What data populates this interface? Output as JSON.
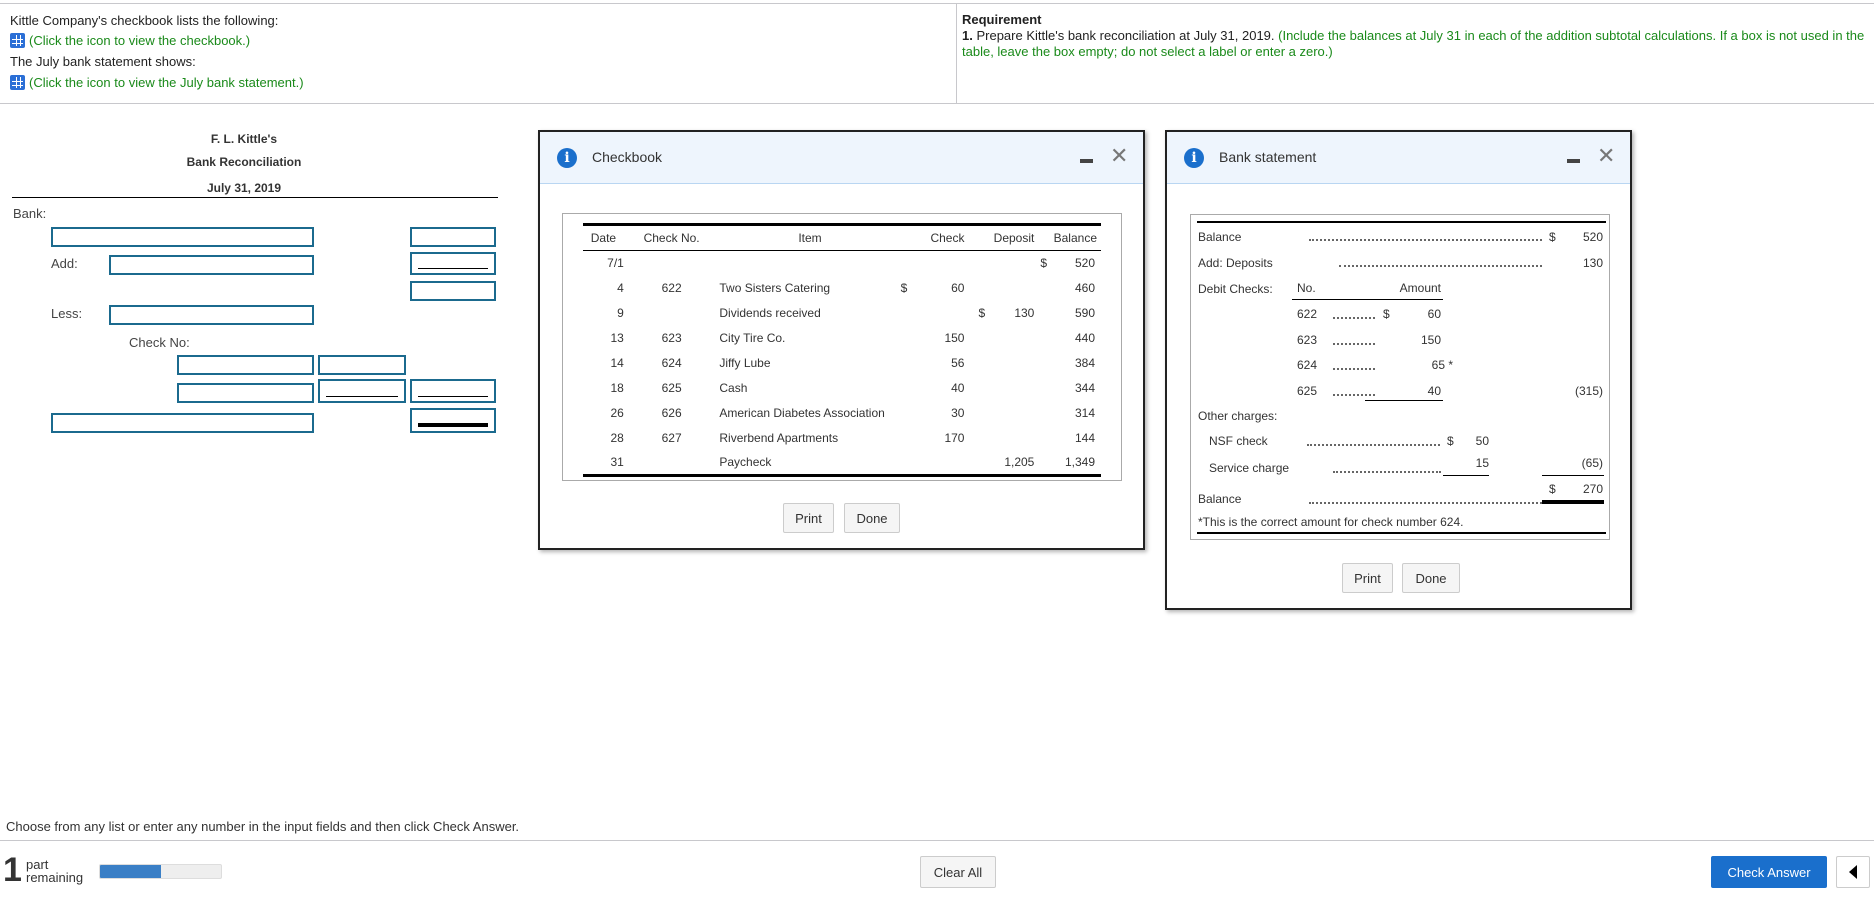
{
  "problem": {
    "line1": "Kittle Company's checkbook lists the following:",
    "link1": "(Click the icon to view the checkbook.)",
    "line2": "The July bank statement shows:",
    "link2": "(Click the icon to view the July bank statement.)",
    "icon": "table-grid-icon"
  },
  "requirement": {
    "heading": "Requirement",
    "number": "1.",
    "text": "Prepare Kittle's bank reconciliation at July 31, 2019.",
    "hint": "(Include the balances at July 31 in each of the addition subtotal calculations. If a box is not used in the table, leave the box empty; do not select a label or enter a zero.)"
  },
  "reconciliation": {
    "company": "F. L. Kittle's",
    "title": "Bank Reconciliation",
    "date": "July 31, 2019",
    "bank_label": "Bank:",
    "add_label": "Add:",
    "less_label": "Less:",
    "check_no_label": "Check No:"
  },
  "checkbook": {
    "title": "Checkbook",
    "headers": [
      "Date",
      "Check No.",
      "Item",
      "Check",
      "Deposit",
      "Balance"
    ],
    "rows": [
      {
        "date": "7/1",
        "no": "",
        "item": "",
        "check_cur": "",
        "check": "",
        "dep_cur": "",
        "deposit": "",
        "bal_cur": "$",
        "balance": "520"
      },
      {
        "date": "4",
        "no": "622",
        "item": "Two Sisters Catering",
        "check_cur": "$",
        "check": "60",
        "dep_cur": "",
        "deposit": "",
        "bal_cur": "",
        "balance": "460"
      },
      {
        "date": "9",
        "no": "",
        "item": "Dividends received",
        "check_cur": "",
        "check": "",
        "dep_cur": "$",
        "deposit": "130",
        "bal_cur": "",
        "balance": "590"
      },
      {
        "date": "13",
        "no": "623",
        "item": "City Tire Co.",
        "check_cur": "",
        "check": "150",
        "dep_cur": "",
        "deposit": "",
        "bal_cur": "",
        "balance": "440"
      },
      {
        "date": "14",
        "no": "624",
        "item": "Jiffy Lube",
        "check_cur": "",
        "check": "56",
        "dep_cur": "",
        "deposit": "",
        "bal_cur": "",
        "balance": "384"
      },
      {
        "date": "18",
        "no": "625",
        "item": "Cash",
        "check_cur": "",
        "check": "40",
        "dep_cur": "",
        "deposit": "",
        "bal_cur": "",
        "balance": "344"
      },
      {
        "date": "26",
        "no": "626",
        "item": "American Diabetes Association",
        "check_cur": "",
        "check": "30",
        "dep_cur": "",
        "deposit": "",
        "bal_cur": "",
        "balance": "314"
      },
      {
        "date": "28",
        "no": "627",
        "item": "Riverbend Apartments",
        "check_cur": "",
        "check": "170",
        "dep_cur": "",
        "deposit": "",
        "bal_cur": "",
        "balance": "144"
      },
      {
        "date": "31",
        "no": "",
        "item": "Paycheck",
        "check_cur": "",
        "check": "",
        "dep_cur": "",
        "deposit": "1,205",
        "bal_cur": "",
        "balance": "1,349"
      }
    ],
    "print": "Print",
    "done": "Done"
  },
  "bank_statement": {
    "title": "Bank statement",
    "balance_label": "Balance",
    "balance_cur": "$",
    "balance_value": "520",
    "deposits_label": "Add: Deposits",
    "deposits_value": "130",
    "debit_label": "Debit Checks:",
    "no_header": "No.",
    "amount_header": "Amount",
    "checks": [
      {
        "no": "622",
        "cur": "$",
        "amount": "60"
      },
      {
        "no": "623",
        "cur": "",
        "amount": "150"
      },
      {
        "no": "624",
        "cur": "",
        "amount": "65 *"
      },
      {
        "no": "625",
        "cur": "",
        "amount": "40"
      }
    ],
    "checks_total": "(315)",
    "other_label": "Other charges:",
    "nsf_label": "NSF check",
    "nsf_cur": "$",
    "nsf_value": "50",
    "service_label": "Service charge",
    "service_value": "15",
    "other_total": "(65)",
    "end_balance_label": "Balance",
    "end_cur": "$",
    "end_value": "270",
    "footnote": "*This is the correct amount for check number 624.",
    "print": "Print",
    "done": "Done"
  },
  "footer": {
    "instruction": "Choose from any list or enter any number in the input fields and then click Check Answer.",
    "parts_count": "1",
    "parts_line1": "part",
    "parts_line2": "remaining",
    "progress_percent": 50,
    "clear_all": "Clear All",
    "check_answer": "Check Answer",
    "accent": "#1a6fcc"
  }
}
